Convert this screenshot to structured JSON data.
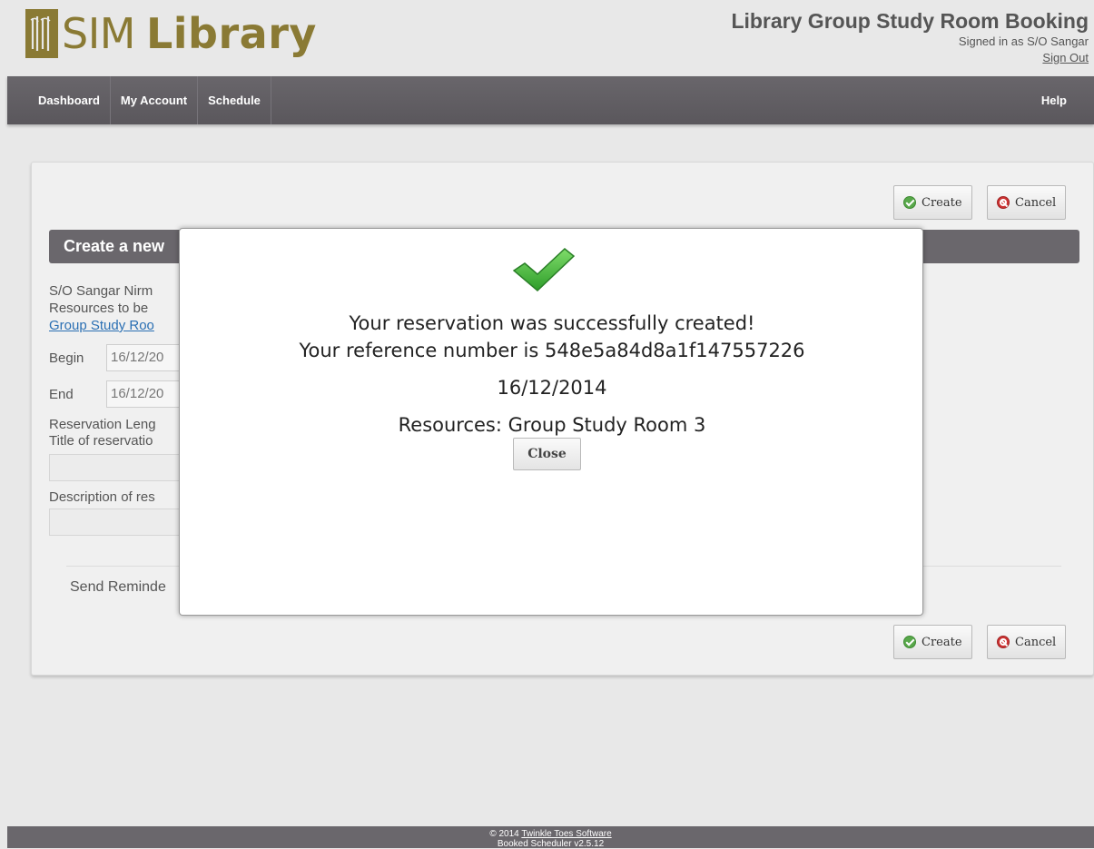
{
  "header": {
    "logo_sim": "SIM",
    "logo_library": "Library",
    "app_title": "Library Group Study Room Booking",
    "signed_in_text": "Signed in as S/O Sangar",
    "sign_out": "Sign Out"
  },
  "nav": {
    "items": [
      "Dashboard",
      "My Account",
      "Schedule"
    ],
    "help": "Help"
  },
  "form": {
    "create_label": "Create",
    "cancel_label": "Cancel",
    "section_title": "Create a new",
    "owner_name": "S/O Sangar Nirm",
    "resources_label": "Resources to be",
    "resource_link": "Group Study Roo",
    "begin_label": "Begin",
    "begin_value": "16/12/20",
    "end_label": "End",
    "end_value": "16/12/20",
    "length_label": "Reservation Leng",
    "title_label": "Title of reservatio",
    "description_label": "Description of res",
    "reminder_label": "Send Reminde"
  },
  "modal": {
    "success_message": "Your reservation was successfully created!",
    "reference_text": "Your reference number is 548e5a84d8a1f147557226",
    "date": "16/12/2014",
    "resources_text": "Resources: Group Study Room 3",
    "close_label": "Close"
  },
  "footer": {
    "copyright": "© 2014",
    "company_link": "Twinkle Toes Software",
    "version": "Booked Scheduler v2.5.12"
  },
  "colors": {
    "logo": "#8a7a34",
    "nav_bg": "#5f5c61",
    "link": "#2a6fb3",
    "check_green": "#3fb43c"
  }
}
